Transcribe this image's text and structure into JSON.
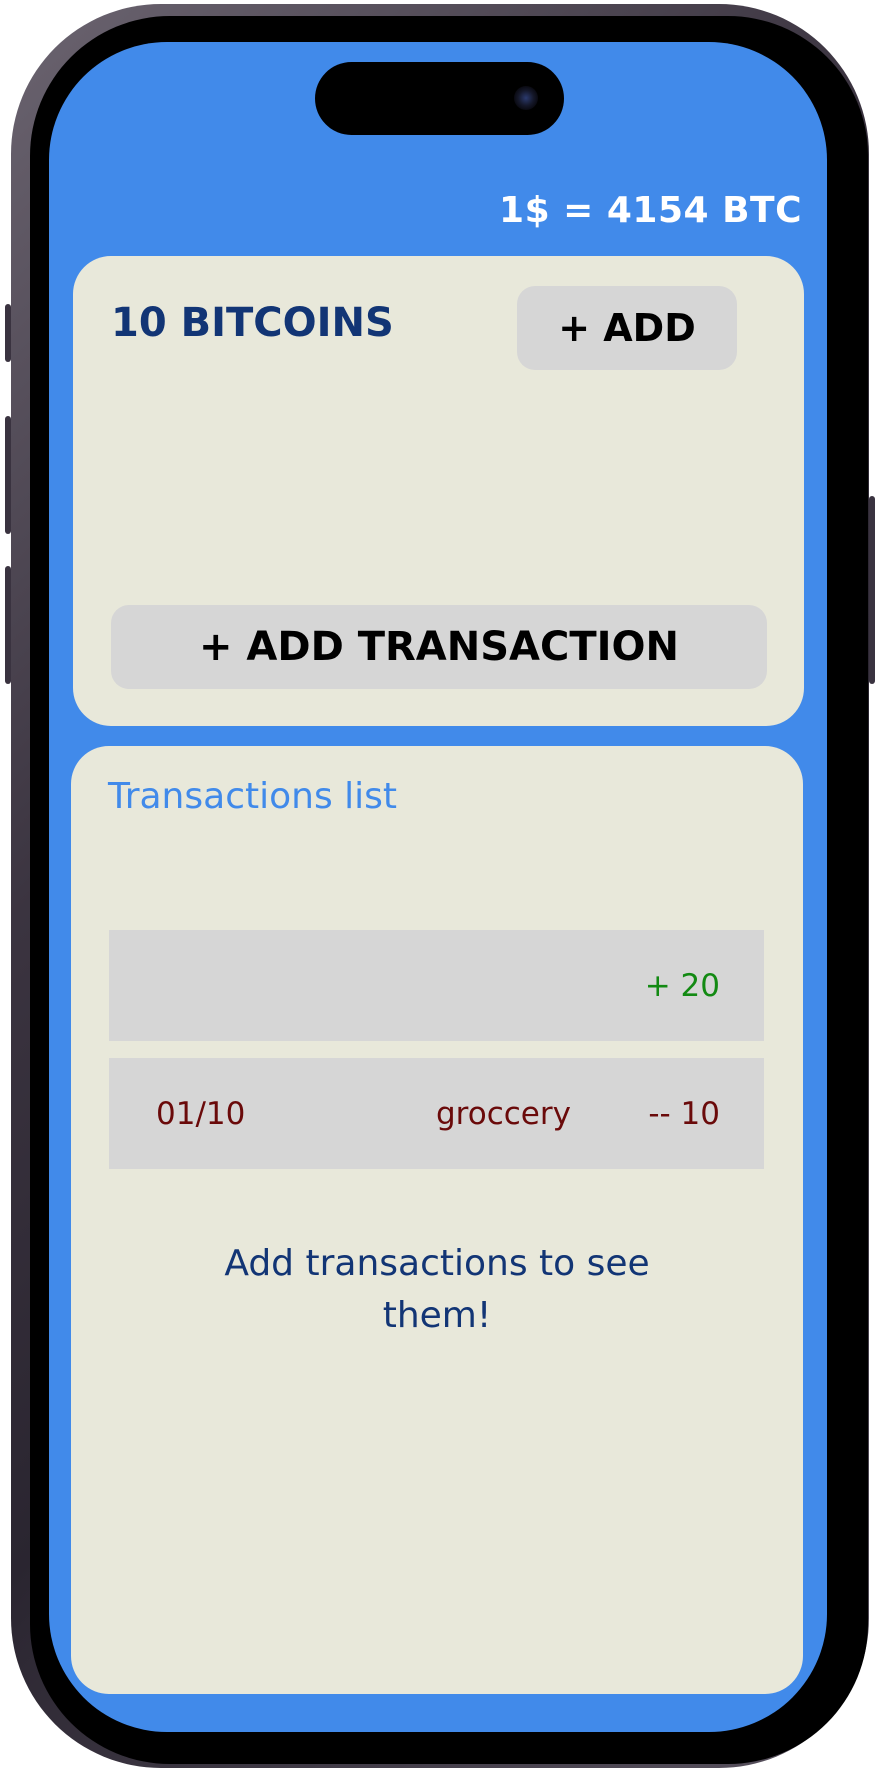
{
  "header": {
    "rate": "1$ = 4154 BTC"
  },
  "balance_card": {
    "balance": "10 BITCOINS",
    "add_label": "+ ADD",
    "add_transaction_label": "+ ADD TRANSACTION"
  },
  "transactions": {
    "title": "Transactions list",
    "rows": [
      {
        "date": "",
        "description": "",
        "amount": "+ 20",
        "kind": "income"
      },
      {
        "date": "01/10",
        "description": "groccery",
        "amount": "-- 10",
        "kind": "expense"
      }
    ],
    "empty_message": "Add transactions to see them!"
  },
  "colors": {
    "screen_background": "#418aea",
    "card_background": "#e8e8da",
    "button_background": "#d6d6d6",
    "navy_text": "#123575",
    "income": "#138a13",
    "expense": "#6a0a0a"
  }
}
